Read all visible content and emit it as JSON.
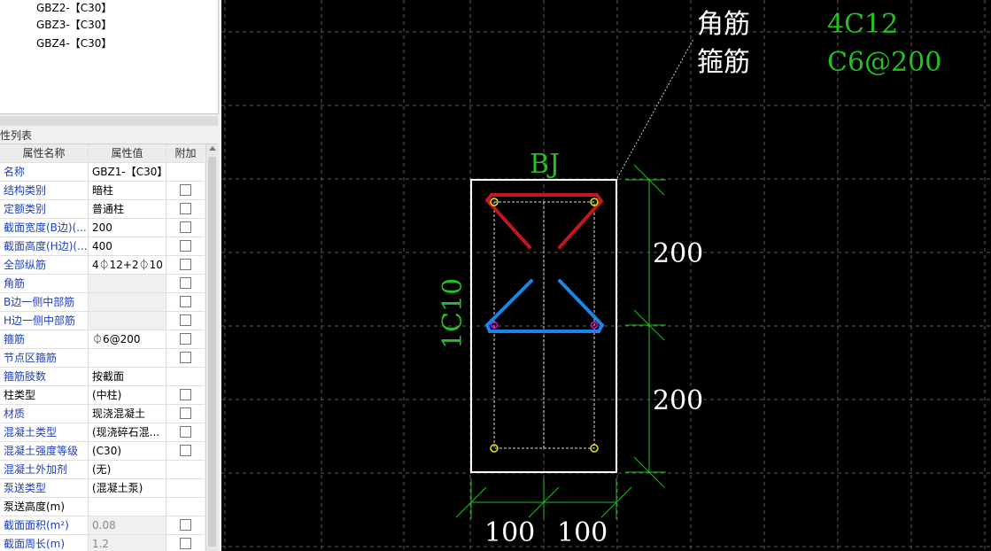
{
  "tree": {
    "items": [
      "GBZ2-【C30】",
      "GBZ3-【C30】",
      "GBZ4-【C30】"
    ]
  },
  "panel": {
    "title_partial": "性列表",
    "columns": [
      "属性名称",
      "属性值",
      "附加"
    ],
    "rows": [
      {
        "name": "名称",
        "value": "GBZ1-【C30】",
        "check": false,
        "disabled": false,
        "blue": true
      },
      {
        "name": "结构类别",
        "value": "暗柱",
        "check": true,
        "disabled": false,
        "blue": true
      },
      {
        "name": "定额类别",
        "value": "普通柱",
        "check": true,
        "disabled": false,
        "blue": true
      },
      {
        "name": "截面宽度(B边)(...",
        "value": "200",
        "check": true,
        "disabled": false,
        "blue": true
      },
      {
        "name": "截面高度(H边)(...",
        "value": "400",
        "check": true,
        "disabled": false,
        "blue": true
      },
      {
        "name": "全部纵筋",
        "value": "4⏀12+2⏀10",
        "check": true,
        "disabled": false,
        "blue": true
      },
      {
        "name": "角筋",
        "value": "",
        "check": true,
        "disabled": true,
        "blue": true
      },
      {
        "name": "B边一侧中部筋",
        "value": "",
        "check": true,
        "disabled": true,
        "blue": true
      },
      {
        "name": "H边一侧中部筋",
        "value": "",
        "check": true,
        "disabled": true,
        "blue": true
      },
      {
        "name": "箍筋",
        "value": "⏀6@200",
        "check": true,
        "disabled": false,
        "blue": true
      },
      {
        "name": "节点区箍筋",
        "value": "",
        "check": true,
        "disabled": false,
        "blue": true
      },
      {
        "name": "箍筋肢数",
        "value": "按截面",
        "check": false,
        "disabled": false,
        "blue": true
      },
      {
        "name": "柱类型",
        "value": "(中柱)",
        "check": true,
        "disabled": false,
        "blue": false
      },
      {
        "name": "材质",
        "value": "现浇混凝土",
        "check": true,
        "disabled": false,
        "blue": true
      },
      {
        "name": "混凝土类型",
        "value": "(现浇碎石混...",
        "check": true,
        "disabled": false,
        "blue": true
      },
      {
        "name": "混凝土强度等级",
        "value": "(C30)",
        "check": true,
        "disabled": false,
        "blue": true
      },
      {
        "name": "混凝土外加剂",
        "value": "(无)",
        "check": false,
        "disabled": false,
        "blue": true
      },
      {
        "name": "泵送类型",
        "value": "(混凝土泵)",
        "check": false,
        "disabled": false,
        "blue": true
      },
      {
        "name": "泵送高度(m)",
        "value": "",
        "check": false,
        "disabled": false,
        "blue": false
      },
      {
        "name": "截面面积(m²)",
        "value": "0.08",
        "check": true,
        "disabled": true,
        "blue": true
      },
      {
        "name": "截面周长(m)",
        "value": "1.2",
        "check": true,
        "disabled": true,
        "blue": true
      }
    ]
  },
  "drawing": {
    "corner_label": "角筋",
    "corner_value": "4C12",
    "stirrup_label": "箍筋",
    "stirrup_value": "C6@200",
    "top_label": "BJ",
    "side_label": "1C10",
    "dim_h1": "200",
    "dim_h2": "200",
    "dim_w1": "100",
    "dim_w2": "100"
  },
  "colors": {
    "grid": "#5a5a5a",
    "outline": "#ffffff",
    "rebar_red": "#c0181c",
    "rebar_blue": "#1b86e8",
    "dim_green": "#22c022",
    "text_green": "#22c022",
    "text_white": "#ffffff",
    "point_yellow": "#e8e800",
    "point_magenta": "#e000e0"
  }
}
